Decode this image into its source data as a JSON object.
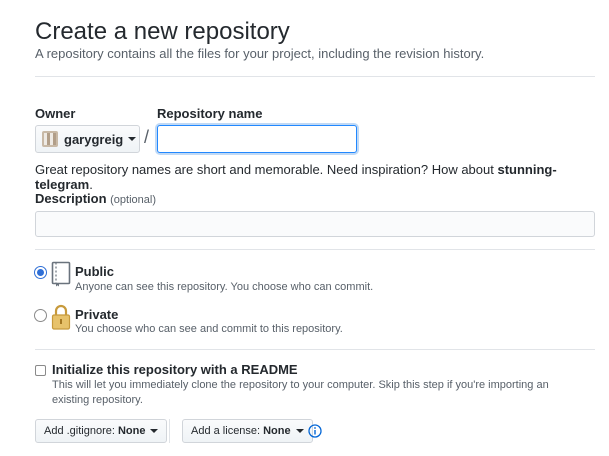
{
  "page": {
    "title": "Create a new repository",
    "subtitle": "A repository contains all the files for your project, including the revision history."
  },
  "owner": {
    "label": "Owner",
    "value": "garygreig",
    "separator": "/"
  },
  "repo_name": {
    "label": "Repository name",
    "value": "",
    "placeholder": ""
  },
  "hint": {
    "prefix": "Great repository names are short and memorable. Need inspiration? How about ",
    "suggestion": "stunning-telegram",
    "suffix": "."
  },
  "description": {
    "label": "Description",
    "optional": "(optional)",
    "value": ""
  },
  "visibility": {
    "public": {
      "title": "Public",
      "description": "Anyone can see this repository. You choose who can commit.",
      "selected": true
    },
    "private": {
      "title": "Private",
      "description": "You choose who can see and commit to this repository.",
      "selected": false
    }
  },
  "readme": {
    "title": "Initialize this repository with a README",
    "description": "This will let you immediately clone the repository to your computer. Skip this step if you're importing an existing repository.",
    "checked": false
  },
  "gitignore": {
    "label": "Add .gitignore:",
    "value": "None"
  },
  "license": {
    "label": "Add a license:",
    "value": "None"
  },
  "colors": {
    "accent": "#2188ff",
    "radio_selected": "#2f6fd6",
    "muted_text": "#586069"
  },
  "icons": {
    "public": "repo-book-icon",
    "private": "lock-icon",
    "info": "info-icon",
    "dropdown": "caret-down-icon"
  }
}
